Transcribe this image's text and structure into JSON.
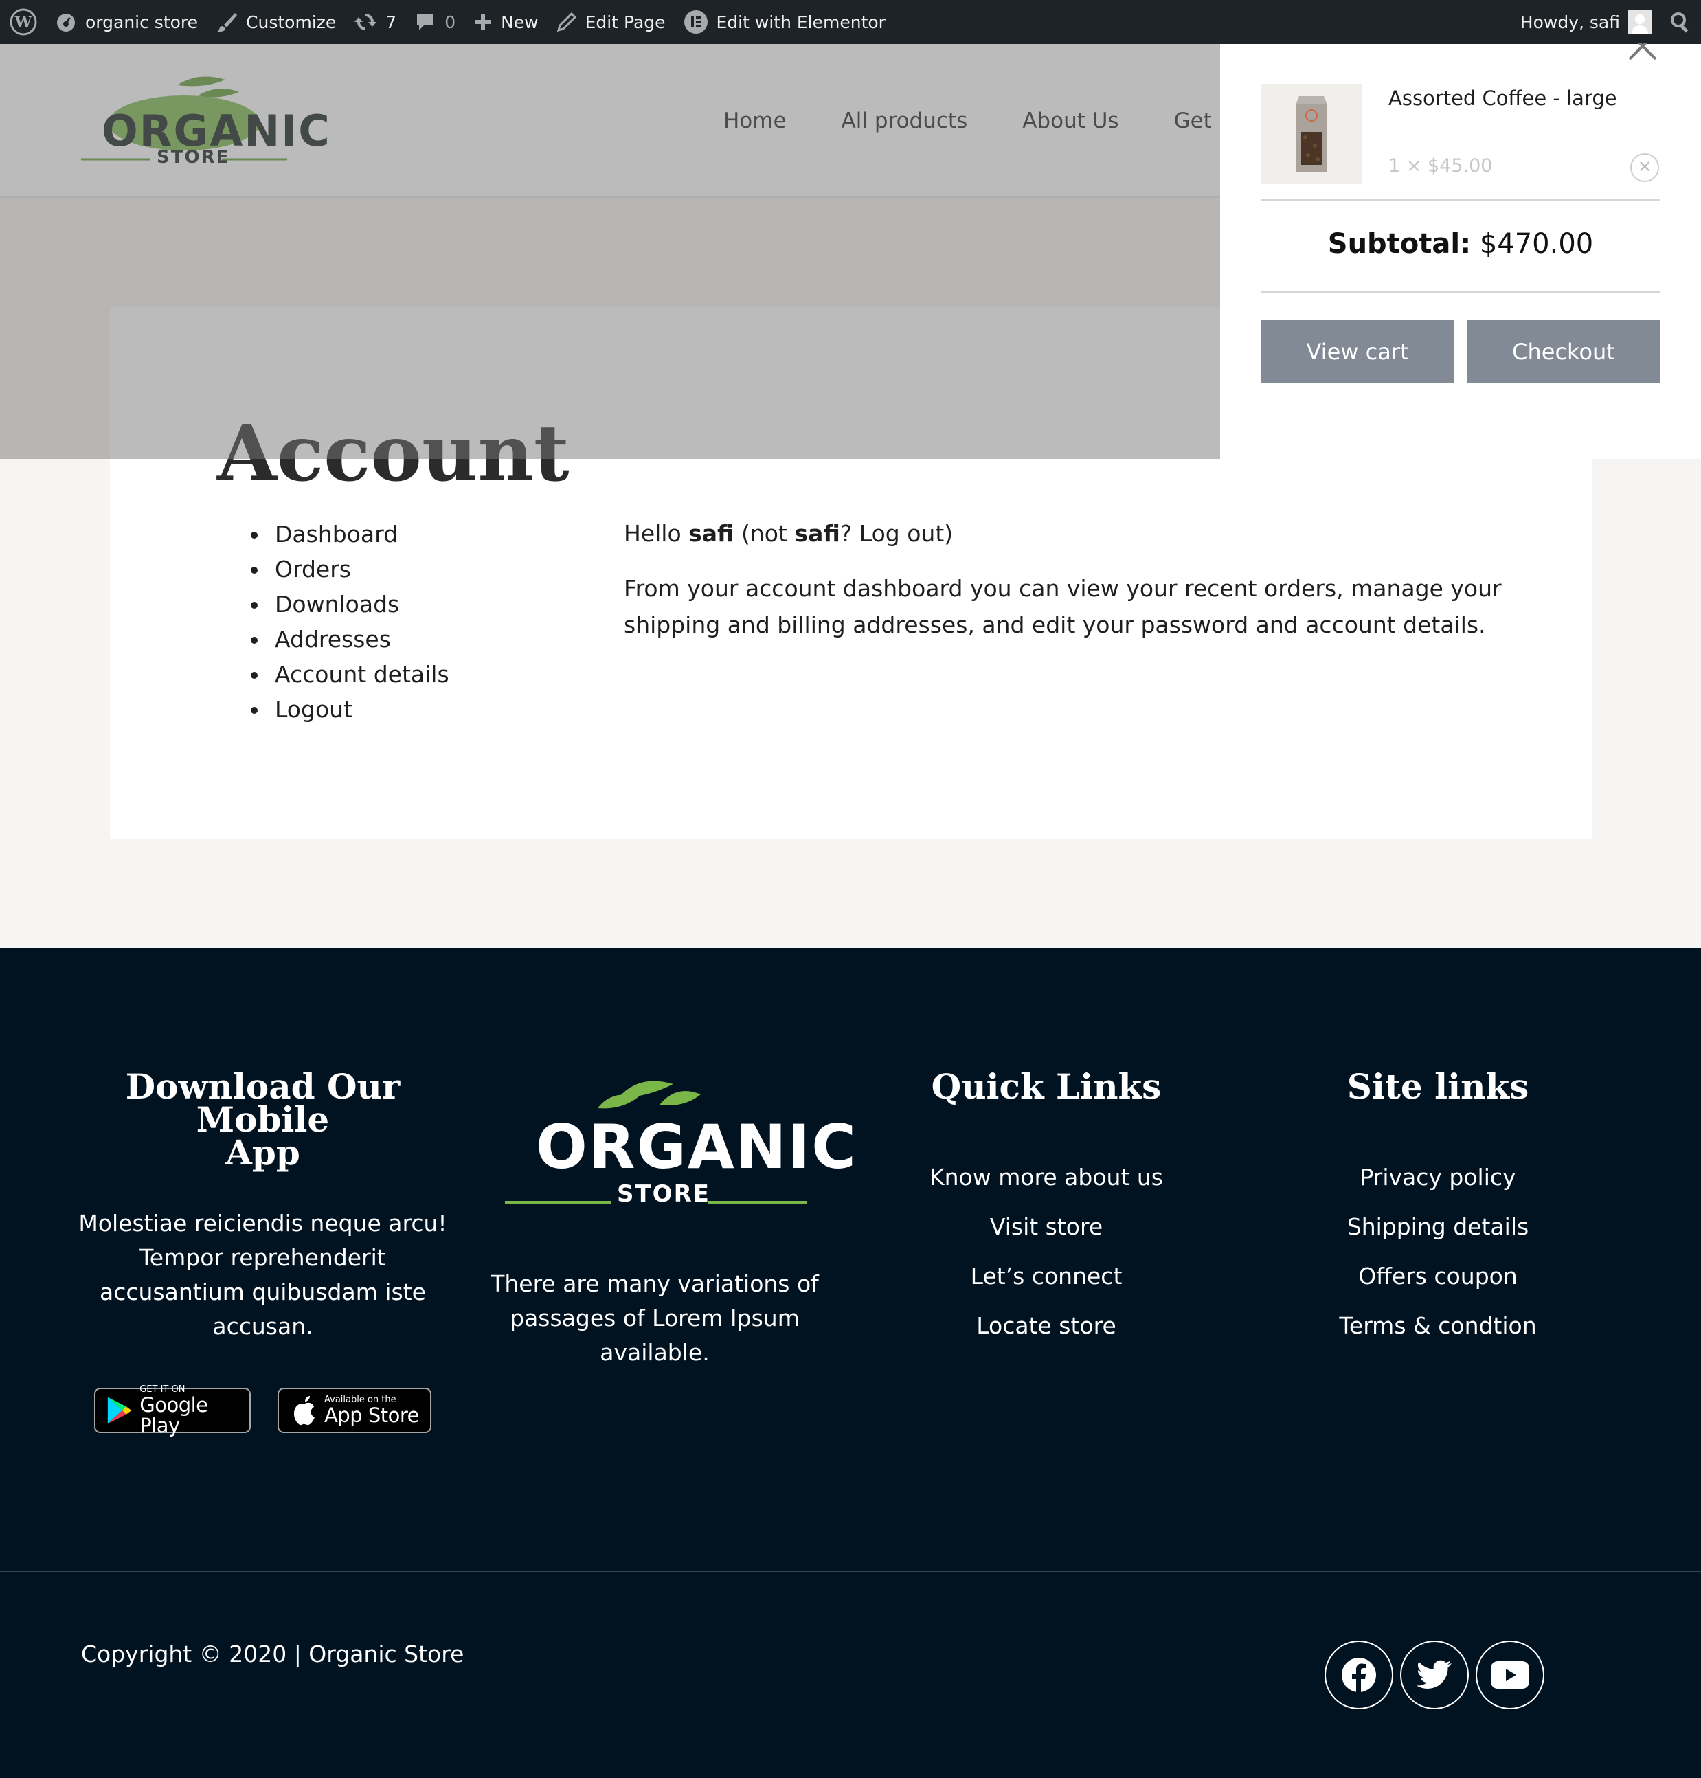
{
  "admin_bar": {
    "site_name": "organic store",
    "customize": "Customize",
    "updates_count": "7",
    "comments_count": "0",
    "new": "New",
    "edit_page": "Edit Page",
    "edit_elementor": "Edit with Elementor",
    "howdy": "Howdy, safi"
  },
  "header": {
    "logo_word": "ORGANIC",
    "logo_sub": "STORE",
    "nav": [
      "Home",
      "All products",
      "About Us",
      "Get In"
    ]
  },
  "page": {
    "title": "Account",
    "account_nav": [
      "Dashboard",
      "Orders",
      "Downloads",
      "Addresses",
      "Account details",
      "Logout"
    ],
    "hello_prefix": "Hello ",
    "user": "safi",
    "not_prefix": " (not ",
    "not_user": "safi",
    "logout_suffix": "? Log out)",
    "dashboard_line1": "From your account dashboard you can view your recent orders, manage your",
    "dashboard_line2": "shipping and billing addresses, and edit your password and account details."
  },
  "mini_cart": {
    "item_name": "Assorted Coffee - large",
    "item_qty": "1 × $45.00",
    "remove_icon": "close-circle-icon",
    "subtotal_label": "Subtotal:",
    "subtotal_value": " $470.00",
    "view_cart": "View cart",
    "checkout": "Checkout"
  },
  "footer": {
    "app_title_1": "Download Our Mobile",
    "app_title_2": "App",
    "app_text": [
      "Molestiae reiciendis neque arcu!",
      "Tempor reprehenderit",
      "accusantium quibusdam iste",
      "accusan."
    ],
    "google_small": "GET IT ON",
    "google_big": "Google Play",
    "apple_small": "Available on the",
    "apple_big": "App Store",
    "logo_word": "ORGANIC",
    "logo_sub": "STORE",
    "logo_text": [
      "There are many variations of",
      "passages of Lorem Ipsum available."
    ],
    "quick_title": "Quick Links",
    "quick_links": [
      "Know more about us",
      "Visit store",
      "Let’s connect",
      "Locate store"
    ],
    "site_title": "Site links",
    "site_links": [
      "Privacy policy",
      "Shipping details",
      "Offers coupon",
      "Terms & condtion"
    ],
    "copyright": "Copyright © 2020 | Organic Store",
    "social": [
      "facebook-icon",
      "twitter-icon",
      "youtube-icon"
    ]
  },
  "colors": {
    "admin_bar": "#1d2327",
    "footer_bg": "#011221",
    "cart_button": "#818a95",
    "logo_green": "#7ab648"
  }
}
